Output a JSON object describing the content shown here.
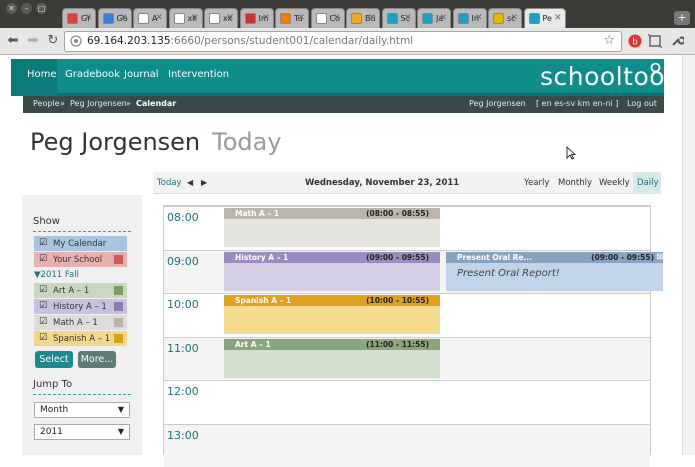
{
  "browser": {
    "tabs": [
      {
        "label": "Gr",
        "color": "#d44638"
      },
      {
        "label": "Go",
        "color": "#3b7ddd"
      },
      {
        "label": "A",
        "color": "#ffffff"
      },
      {
        "label": "xk",
        "color": "#ffffff"
      },
      {
        "label": "xk",
        "color": "#ffffff"
      },
      {
        "label": "Im",
        "color": "#cc3333"
      },
      {
        "label": "Tu",
        "color": "#f57d00"
      },
      {
        "label": "Co",
        "color": "#ffffff"
      },
      {
        "label": "Bu",
        "color": "#f5a623"
      },
      {
        "label": "Sc",
        "color": "#1aa1c5"
      },
      {
        "label": "Ja",
        "color": "#1aa1c5"
      },
      {
        "label": "In",
        "color": "#1aa1c5"
      },
      {
        "label": "sc",
        "color": "#e6b800"
      },
      {
        "label": "Pe",
        "color": "#1aa1c5"
      }
    ],
    "url_host": "69.164.203.135",
    "url_rest": ":6660/persons/student001/calendar/daily.html"
  },
  "header": {
    "nav": [
      "Home",
      "Gradebook",
      "Journal",
      "Intervention"
    ],
    "logo": "schooltool",
    "breadcrumb": {
      "people": "People",
      "sep1": "»",
      "person": "Peg Jorgensen",
      "sep2": "»",
      "current": "Calendar"
    },
    "user": "Peg Jorgensen",
    "langs": "[ en  es-sv  km  en-ni ]",
    "logout": "Log out"
  },
  "page": {
    "title": "Peg Jorgensen",
    "subtitle": "Today"
  },
  "sidebar": {
    "show_label": "Show",
    "calendars": [
      {
        "label": "My Calendar",
        "color": "#a8c4e0",
        "swatch": ""
      },
      {
        "label": "Your School",
        "color": "#e8b0b0",
        "swatch": "#d05a5a"
      }
    ],
    "group_label": "▼2011 Fall",
    "sections": [
      {
        "label": "Art A – 1",
        "color": "#c8d8c0",
        "swatch": "#7a9a6a"
      },
      {
        "label": "History A – 1",
        "color": "#c8c0dc",
        "swatch": "#8a7ab0"
      },
      {
        "label": "Math A – 1",
        "color": "#dcdcdc",
        "swatch": "#b8b4a8"
      },
      {
        "label": "Spanish A – 1",
        "color": "#f2d88a",
        "swatch": "#d4a020"
      }
    ],
    "select_button": "Select",
    "more_button": "More...",
    "jump_label": "Jump To",
    "jump_period": "Month",
    "jump_year": "2011"
  },
  "calendar": {
    "today_link": "Today",
    "prev": "◀",
    "next": "▶",
    "date": "Wednesday, November 23, 2011",
    "views": [
      "Yearly",
      "Monthly",
      "Weekly",
      "Daily"
    ],
    "hours": [
      "08:00",
      "09:00",
      "10:00",
      "11:00",
      "12:00",
      "13:00"
    ],
    "events": [
      {
        "name": "Math A – 1",
        "time": "(08:00 - 08:55)",
        "bar": "#bcb6aa",
        "body": "#e6e4df"
      },
      {
        "name": "History A – 1",
        "time": "(09:00 - 09:55)",
        "bar": "#9a8cc0",
        "body": "#d5cfe6"
      },
      {
        "name": "Spanish A – 1",
        "time": "(10:00 - 10:55)",
        "bar": "#e0a020",
        "body": "#f5dc8e"
      },
      {
        "name": "Art A – 1",
        "time": "(11:00 - 11:55)",
        "bar": "#8aa67c",
        "body": "#d2dfcc"
      }
    ],
    "extra_event": {
      "name": "Present Oral Re...",
      "time": "(09:00 - 09:55)",
      "desc": "Present Oral Report!",
      "bar": "#8aa2c2",
      "body": "#c4d4e8"
    }
  }
}
